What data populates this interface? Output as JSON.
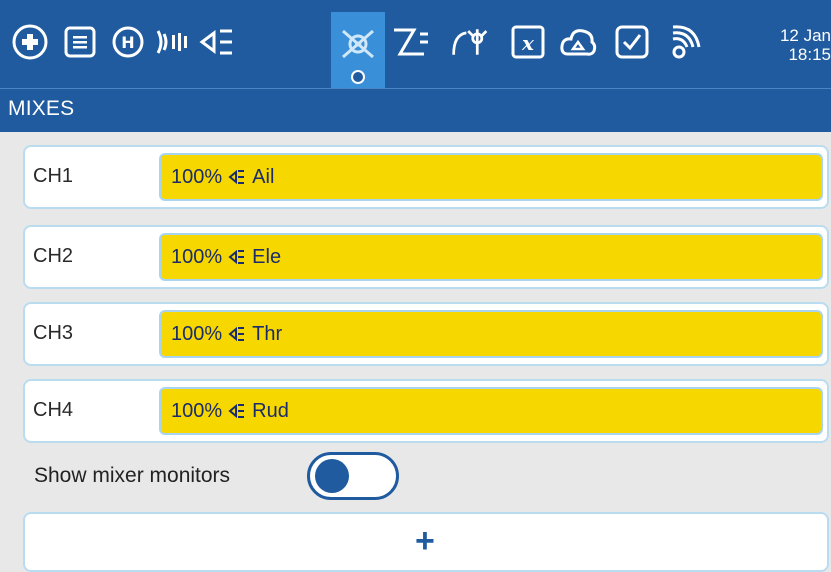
{
  "toolbar": {
    "icons": [
      {
        "name": "add-model-icon"
      },
      {
        "name": "list-icon"
      },
      {
        "name": "heli-icon"
      },
      {
        "name": "signal-icon"
      },
      {
        "name": "inputs-icon"
      },
      {
        "name": "mixes-icon",
        "active": true
      },
      {
        "name": "outputs-icon"
      },
      {
        "name": "curves-icon"
      },
      {
        "name": "variables-icon"
      },
      {
        "name": "cloud-icon"
      },
      {
        "name": "checklist-icon"
      },
      {
        "name": "telemetry-icon"
      }
    ],
    "date": "12 Jan",
    "time": "18:15"
  },
  "section": {
    "title": "MIXES"
  },
  "mixes": [
    {
      "channel": "CH1",
      "weight": "100%",
      "source": "Ail"
    },
    {
      "channel": "CH2",
      "weight": "100%",
      "source": "Ele"
    },
    {
      "channel": "CH3",
      "weight": "100%",
      "source": "Thr"
    },
    {
      "channel": "CH4",
      "weight": "100%",
      "source": "Rud"
    }
  ],
  "monitor": {
    "label": "Show mixer monitors",
    "enabled": false
  },
  "add": {
    "symbol": "+"
  },
  "colors": {
    "header": "#1f5b9e",
    "active_tab": "#3a8fd9",
    "mix_bar": "#f7d700",
    "row_border": "#b9dcf0"
  }
}
